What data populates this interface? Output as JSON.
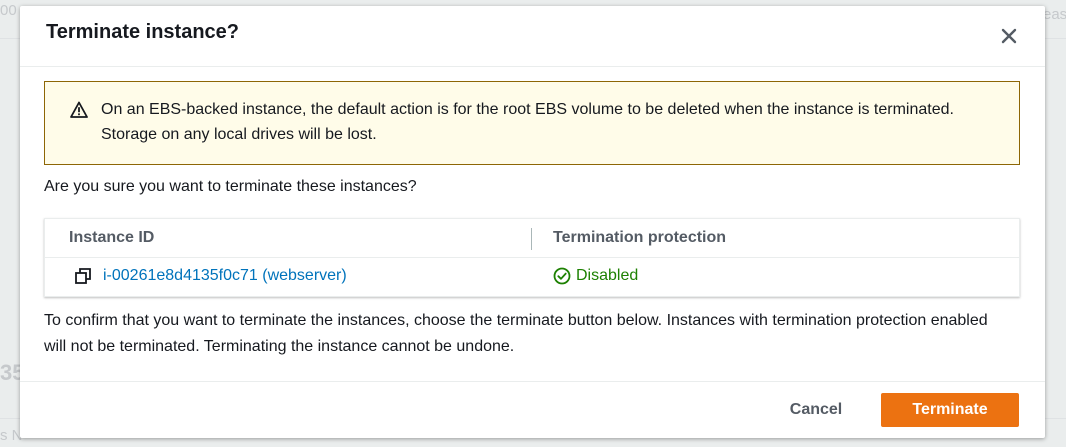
{
  "background": {
    "fragment_top_left": "00",
    "fragment_top_right": "eas",
    "fragment_mid_left": "35",
    "fragment_bottom_left": "s N"
  },
  "modal": {
    "title": "Terminate instance?",
    "close_icon": "close-icon",
    "warning": {
      "icon": "warning-triangle-icon",
      "text": "On an EBS-backed instance, the default action is for the root EBS volume to be deleted when the instance is terminated. Storage on any local drives will be lost."
    },
    "question": "Are you sure you want to terminate these instances?",
    "table": {
      "headers": [
        "Instance ID",
        "Termination protection"
      ],
      "rows": [
        {
          "instance_id": "i-00261e8d4135f0c71 (webserver)",
          "copy_icon": "copy-icon",
          "termination_protection": "Disabled",
          "status_icon": "check-circle-icon"
        }
      ]
    },
    "confirm_text": "To confirm that you want to terminate the instances, choose the terminate button below. Instances with termination protection enabled will not be terminated. Terminating the instance cannot be undone.",
    "footer": {
      "cancel_label": "Cancel",
      "terminate_label": "Terminate"
    }
  },
  "colors": {
    "accent": "#ec7211",
    "link": "#0073bb",
    "success": "#1d8102",
    "warning_bg": "#fffce9",
    "warning_border": "#8d6605"
  }
}
